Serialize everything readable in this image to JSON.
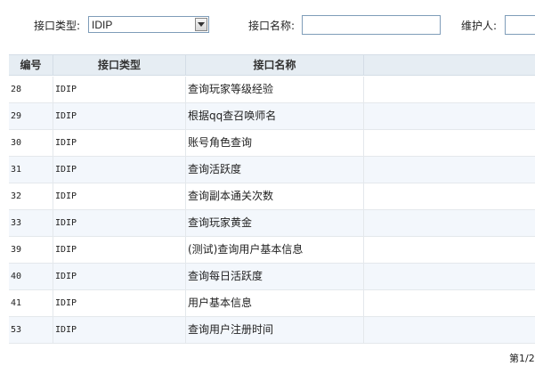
{
  "filters": {
    "type_label": "接口类型:",
    "type_value": "IDIP",
    "name_label": "接口名称:",
    "name_value": "",
    "maintainer_label": "维护人:",
    "maintainer_value": ""
  },
  "table": {
    "columns": [
      "编号",
      "接口类型",
      "接口名称",
      ""
    ],
    "rows": [
      {
        "id": "28",
        "type": "IDIP",
        "name": "查询玩家等级经验"
      },
      {
        "id": "29",
        "type": "IDIP",
        "name": "根据qq查召唤师名"
      },
      {
        "id": "30",
        "type": "IDIP",
        "name": "账号角色查询"
      },
      {
        "id": "31",
        "type": "IDIP",
        "name": "查询活跃度"
      },
      {
        "id": "32",
        "type": "IDIP",
        "name": "查询副本通关次数"
      },
      {
        "id": "33",
        "type": "IDIP",
        "name": "查询玩家黄金"
      },
      {
        "id": "39",
        "type": "IDIP",
        "name": "(测试)查询用户基本信息"
      },
      {
        "id": "40",
        "type": "IDIP",
        "name": "查询每日活跃度"
      },
      {
        "id": "41",
        "type": "IDIP",
        "name": "用户基本信息"
      },
      {
        "id": "53",
        "type": "IDIP",
        "name": "查询用户注册时间"
      }
    ]
  },
  "pager": {
    "text": "第1/2"
  }
}
